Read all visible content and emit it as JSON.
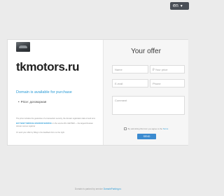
{
  "header": {
    "language": "en"
  },
  "sale": {
    "domain": "tkmotors.ru",
    "availability": "Domain is available for purchase",
    "price_label": "Price: договорная",
    "fine_print": "The price includes the guarantee of a transaction security, the domain registration date of and term",
    "buy_link": "BUY NOW THROUGH ESCROW SERVICE",
    "escrow_note": "on the service RU-CENTER — the largest Russian domain names registrar",
    "contact_note": "Or send your offer by filling in the feedback form on the right."
  },
  "offer_form": {
    "title": "Your offer",
    "name_placeholder": "Name",
    "price_placeholder": "₽ Your price",
    "email_placeholder": "E-mail",
    "phone_placeholder": "Phone",
    "comment_placeholder": "Comment",
    "consent_text": "By submitting this form you agree to the",
    "consent_link": "Terms",
    "send_label": "SEND"
  },
  "footer": {
    "text": "Domain is parked by service",
    "link": "DomainParking.ru"
  },
  "colors": {
    "accent": "#2a9bd6",
    "button": "#3b8bd0",
    "background": "#ebebeb"
  }
}
